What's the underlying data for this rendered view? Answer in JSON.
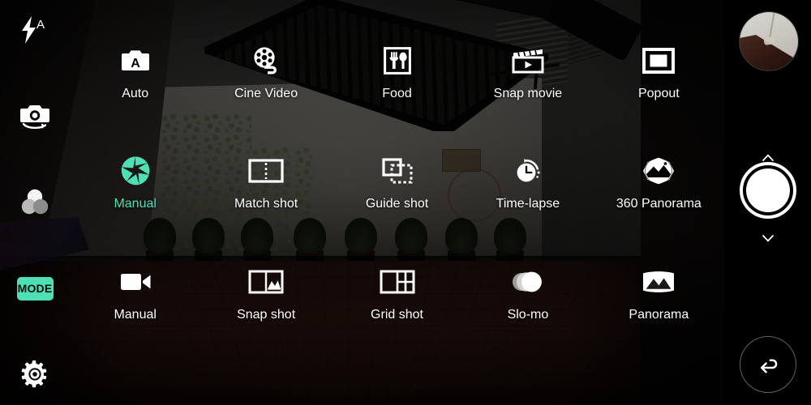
{
  "app": {
    "name": "Camera",
    "screen": "mode-selector",
    "accent_color": "#4ee0b5",
    "label_color": "#ffffff",
    "panel_color": "#000000"
  },
  "left_toolbar": {
    "items": [
      {
        "name": "flash-auto",
        "icon": "flash-auto-icon",
        "label": "A",
        "state": "auto"
      },
      {
        "name": "switch-camera",
        "icon": "camera-switch-icon",
        "label": ""
      },
      {
        "name": "filters",
        "icon": "filter-circles-icon",
        "label": ""
      },
      {
        "name": "mode",
        "icon": "mode-badge-icon",
        "label": "MODE",
        "active": true
      },
      {
        "name": "settings",
        "icon": "gear-icon",
        "label": ""
      }
    ],
    "mode_badge_text": "MODE"
  },
  "mode_grid": {
    "selected": "Manual",
    "rows": [
      {
        "cells": [
          {
            "label": "Auto",
            "icon": "camera-auto-icon",
            "active": false
          },
          {
            "label": "Cine Video",
            "icon": "film-reel-icon",
            "active": false
          },
          {
            "label": "Food",
            "icon": "fork-spoon-icon",
            "active": false
          },
          {
            "label": "Snap movie",
            "icon": "clapperboard-play-icon",
            "active": false
          },
          {
            "label": "Popout",
            "icon": "popout-frame-icon",
            "active": false
          }
        ]
      },
      {
        "cells": [
          {
            "label": "Manual",
            "icon": "aperture-icon",
            "active": true
          },
          {
            "label": "Match shot",
            "icon": "match-shot-icon",
            "active": false
          },
          {
            "label": "Guide shot",
            "icon": "guide-shot-icon",
            "active": false
          },
          {
            "label": "Time-lapse",
            "icon": "clock-timelapse-icon",
            "active": false
          },
          {
            "label": "360 Panorama",
            "icon": "sphere-panorama-icon",
            "active": false
          }
        ]
      },
      {
        "cells": [
          {
            "label": "Manual",
            "icon": "video-camera-icon",
            "active": false
          },
          {
            "label": "Snap shot",
            "icon": "snap-shot-icon",
            "active": false
          },
          {
            "label": "Grid shot",
            "icon": "grid-shot-icon",
            "active": false
          },
          {
            "label": "Slo-mo",
            "icon": "slomo-circles-icon",
            "active": false
          },
          {
            "label": "Panorama",
            "icon": "panorama-icon",
            "active": false
          }
        ]
      }
    ]
  },
  "right_panel": {
    "thumbnail": {
      "name": "last-photo-thumbnail"
    },
    "shutter": {
      "name": "shutter-button"
    },
    "chevron_up": {
      "name": "chevron-up-icon"
    },
    "chevron_down": {
      "name": "chevron-down-icon"
    },
    "back": {
      "name": "back-button",
      "icon": "back-arrow-icon"
    }
  }
}
